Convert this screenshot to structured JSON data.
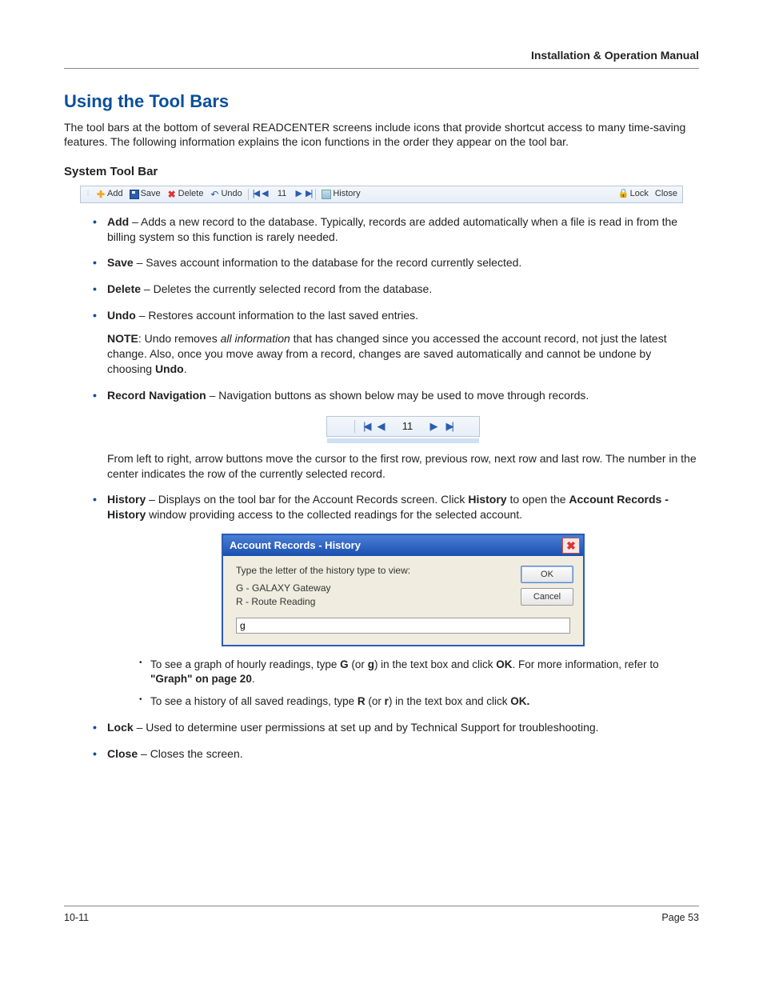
{
  "header": {
    "doc_title": "Installation & Operation Manual"
  },
  "section": {
    "title": "Using the Tool Bars",
    "intro": "The tool bars at the bottom of several READCENTER screens include icons that provide shortcut access to many time-saving features. The following information explains the icon functions in the order they appear on the tool bar.",
    "subhead": "System Tool Bar"
  },
  "toolbar": {
    "add": "Add",
    "save": "Save",
    "del": "Delete",
    "undo": "Undo",
    "rownum": "11",
    "history": "History",
    "lock": "Lock",
    "close": "Close"
  },
  "items": {
    "add": {
      "term": "Add",
      "desc": " – Adds a new record to the database. Typically, records are added automatically when a file is read in from the billing system so this function is rarely needed."
    },
    "save": {
      "term": "Save",
      "desc": " – Saves account information to the database for the record currently selected."
    },
    "delete": {
      "term": "Delete",
      "desc": " – Deletes the currently selected record from the database."
    },
    "undo": {
      "term": "Undo",
      "desc": " – Restores account information to the last saved entries."
    },
    "note": {
      "label": "NOTE",
      "p1": ": Undo removes ",
      "italic": "all information",
      "p2": " that has changed since you accessed the account record, not just the latest change. Also, once you move away from a record, changes are saved automatically and cannot be undone by choosing ",
      "bold": "Undo",
      "p3": "."
    },
    "nav": {
      "term": "Record Navigation",
      "desc": " – Navigation buttons as shown below may be used to move through records.",
      "rownum": "11",
      "follow": "From left to right, arrow buttons move the cursor to the first row, previous row, next row and last row. The number in the center indicates the row of the currently selected record."
    },
    "history": {
      "term": "History",
      "p1": " – Displays on the tool bar for the Account Records screen. Click ",
      "b1": "History",
      "p2": " to open the ",
      "b2": "Account Records - History",
      "p3": " window providing access to the collected readings for the selected account."
    },
    "sub_g": {
      "p1": "To see a graph of hourly readings, type ",
      "b1": "G",
      "p2": " (or ",
      "b2": "g",
      "p3": ") in the text box and click ",
      "b3": "OK",
      "p4": ". For more information, refer to ",
      "b4": "\"Graph\" on page 20",
      "p5": "."
    },
    "sub_r": {
      "p1": "To see a history of all saved readings, type ",
      "b1": "R",
      "p2": " (or ",
      "b2": "r",
      "p3": ") in the text box and click ",
      "b3": "OK."
    },
    "lock": {
      "term": "Lock",
      "desc": " – Used to determine user permissions at set up and by Technical Support for troubleshooting."
    },
    "close": {
      "term": "Close",
      "desc": " – Closes the screen."
    }
  },
  "dialog": {
    "title": "Account Records - History",
    "prompt": "Type the letter of the history type to view:",
    "opt_g": "G - GALAXY Gateway",
    "opt_r": "R - Route Reading",
    "ok": "OK",
    "cancel": "Cancel",
    "input_value": "g"
  },
  "footer": {
    "left": "10-11",
    "right": "Page 53"
  }
}
